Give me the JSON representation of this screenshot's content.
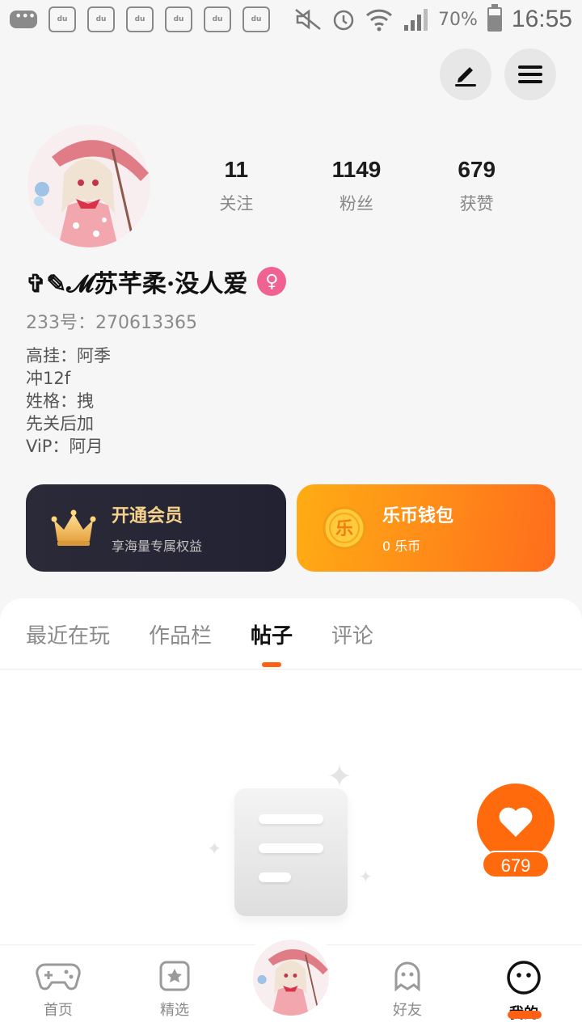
{
  "status_bar": {
    "battery_text": "70%",
    "battery_level": 0.7,
    "time": "16:55",
    "notification_icons": [
      "message-icon",
      "baidu-icon",
      "baidu-icon",
      "baidu-icon",
      "baidu-icon",
      "baidu-icon",
      "baidu-icon"
    ],
    "baidu_label": "du"
  },
  "profile": {
    "stats": [
      {
        "value": "11",
        "label": "关注"
      },
      {
        "value": "1149",
        "label": "粉丝"
      },
      {
        "value": "679",
        "label": "获赞"
      }
    ],
    "nickname": "✞✎𝓜苏芊柔·没人爱",
    "gender_symbol": "♀",
    "user_id": "233号：270613365",
    "bio_lines": [
      "高挂：阿季",
      "冲12f",
      "姓格：拽",
      "先关后加",
      "ViP：阿月"
    ]
  },
  "cards": {
    "vip": {
      "title": "开通会员",
      "subtitle": "享海量专属权益"
    },
    "wallet": {
      "title": "乐币钱包",
      "subtitle": "0 乐币",
      "coin_glyph": "乐"
    }
  },
  "tabs": [
    {
      "label": "最近在玩",
      "active": false
    },
    {
      "label": "作品栏",
      "active": false
    },
    {
      "label": "帖子",
      "active": true
    },
    {
      "label": "评论",
      "active": false
    }
  ],
  "like": {
    "count": "679"
  },
  "bottom_nav": [
    {
      "label": "首页",
      "icon": "gamepad-icon",
      "active": false
    },
    {
      "label": "精选",
      "icon": "star-icon",
      "active": false
    },
    {
      "label": "好友",
      "icon": "ghost-icon",
      "active": false
    },
    {
      "label": "我的",
      "icon": "smile-icon",
      "active": true
    }
  ],
  "colors": {
    "accent": "#ff6114",
    "vip_card": "#2b2a38",
    "wallet_card": "#ff8a14",
    "gender_badge": "#f06292"
  }
}
